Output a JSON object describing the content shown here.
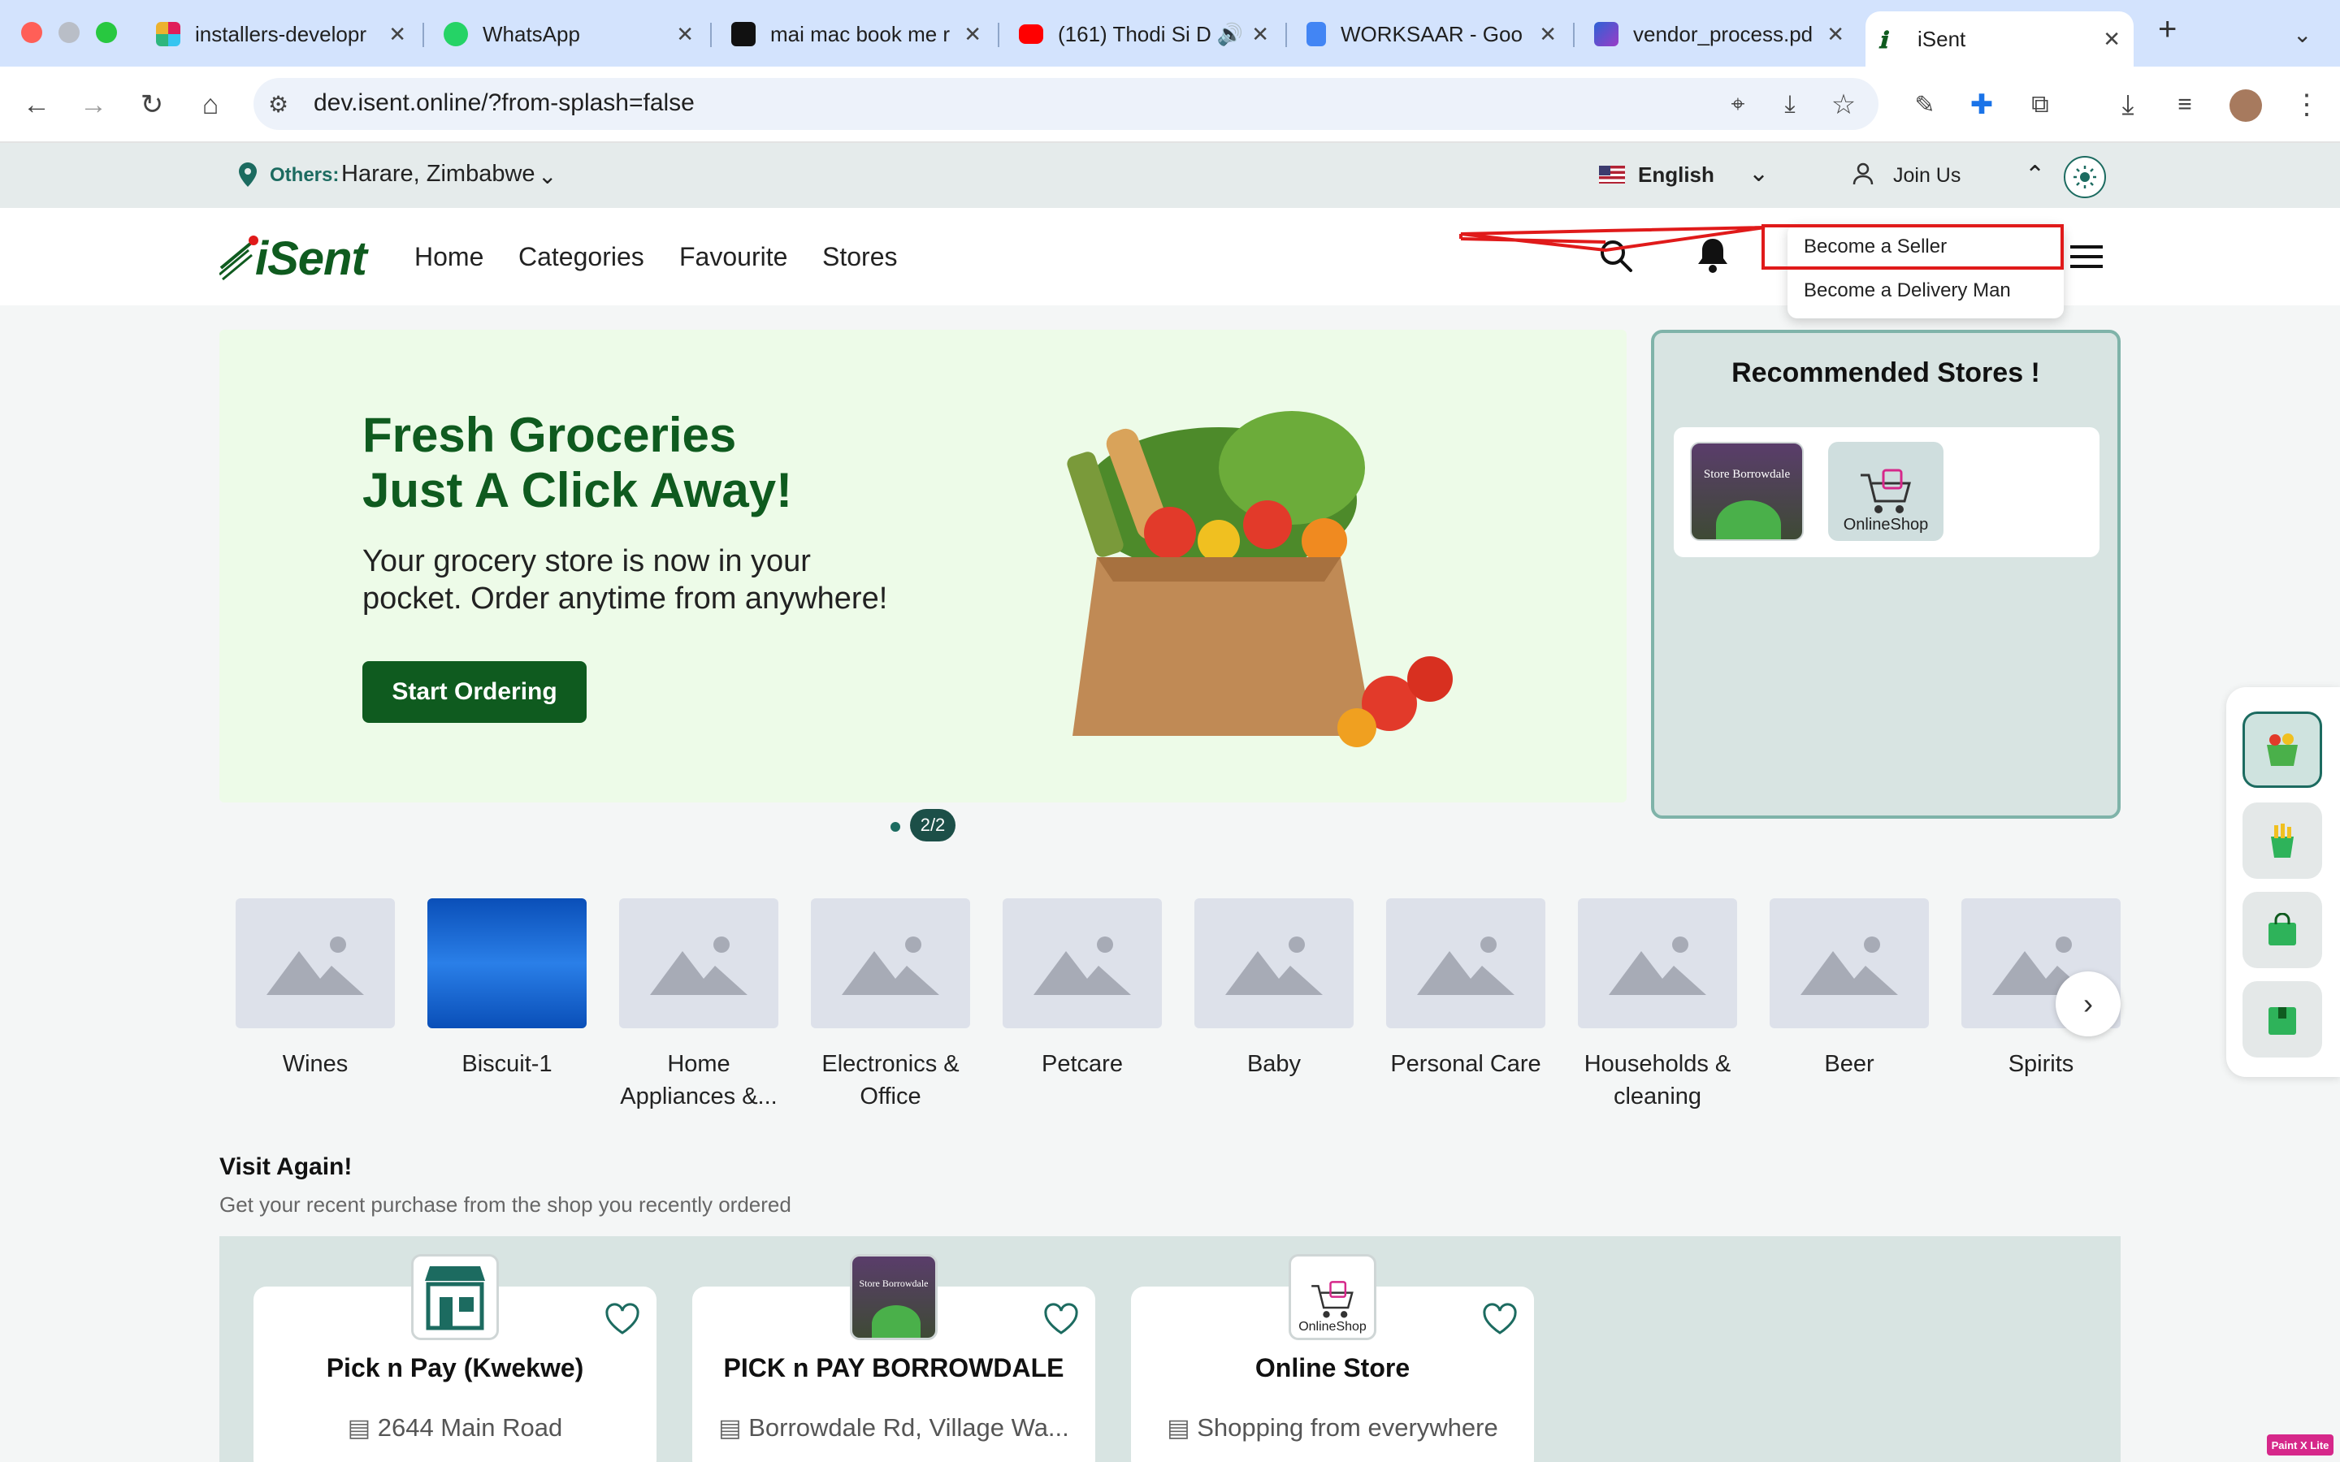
{
  "browser": {
    "tabs": [
      {
        "title": "installers-developr",
        "icon": "slack-icon"
      },
      {
        "title": "WhatsApp",
        "icon": "whatsapp-icon"
      },
      {
        "title": "mai mac book me r",
        "icon": "ai-logo-icon"
      },
      {
        "title": "(161) Thodi Si D",
        "icon": "youtube-icon"
      },
      {
        "title": "WORKSAAR - Goo",
        "icon": "google-docs-icon"
      },
      {
        "title": "vendor_process.pd",
        "icon": "pdf-icon"
      },
      {
        "title": "iSent",
        "icon": "isent-icon"
      }
    ],
    "url": "dev.isent.online/?from-splash=false"
  },
  "topbar": {
    "location_prefix": "Others:",
    "location": "Harare, Zimbabwe",
    "language": "English",
    "join": "Join Us"
  },
  "nav": {
    "brand": "iSent",
    "links": [
      "Home",
      "Categories",
      "Favourite",
      "Stores"
    ]
  },
  "dropdown": {
    "items": [
      "Become a Seller",
      "Become a Delivery Man"
    ]
  },
  "hero": {
    "title_line1": "Fresh Groceries",
    "title_line2": "Just A Click Away!",
    "subtitle_line1": "Your grocery store is now in your",
    "subtitle_line2": "pocket. Order anytime from anywhere!",
    "cta": "Start Ordering",
    "pager": "2/2"
  },
  "recommended": {
    "title": "Recommended Stores !",
    "stores": [
      {
        "logo_text": "Store Borrowdale"
      },
      {
        "logo_text": "OnlineShop"
      }
    ]
  },
  "categories": [
    "Wines",
    "Biscuit-1",
    "Home Appliances &...",
    "Electronics & Office",
    "Petcare",
    "Baby",
    "Personal Care",
    "Households & cleaning",
    "Beer",
    "Spirits"
  ],
  "visit_again": {
    "title": "Visit Again!",
    "subtitle": "Get your recent purchase from the shop you recently ordered",
    "stores": [
      {
        "name": "Pick n Pay (Kwekwe)",
        "address": "2644 Main Road"
      },
      {
        "name": "PICK n PAY BORROWDALE",
        "address": "Borrowdale Rd, Village Wa..."
      },
      {
        "name": "Online Store",
        "address": "Shopping from everywhere"
      }
    ]
  },
  "colors": {
    "brand_green": "#0f5b1f",
    "teal": "#1c6b60",
    "annotation_red": "#e01a1a"
  }
}
